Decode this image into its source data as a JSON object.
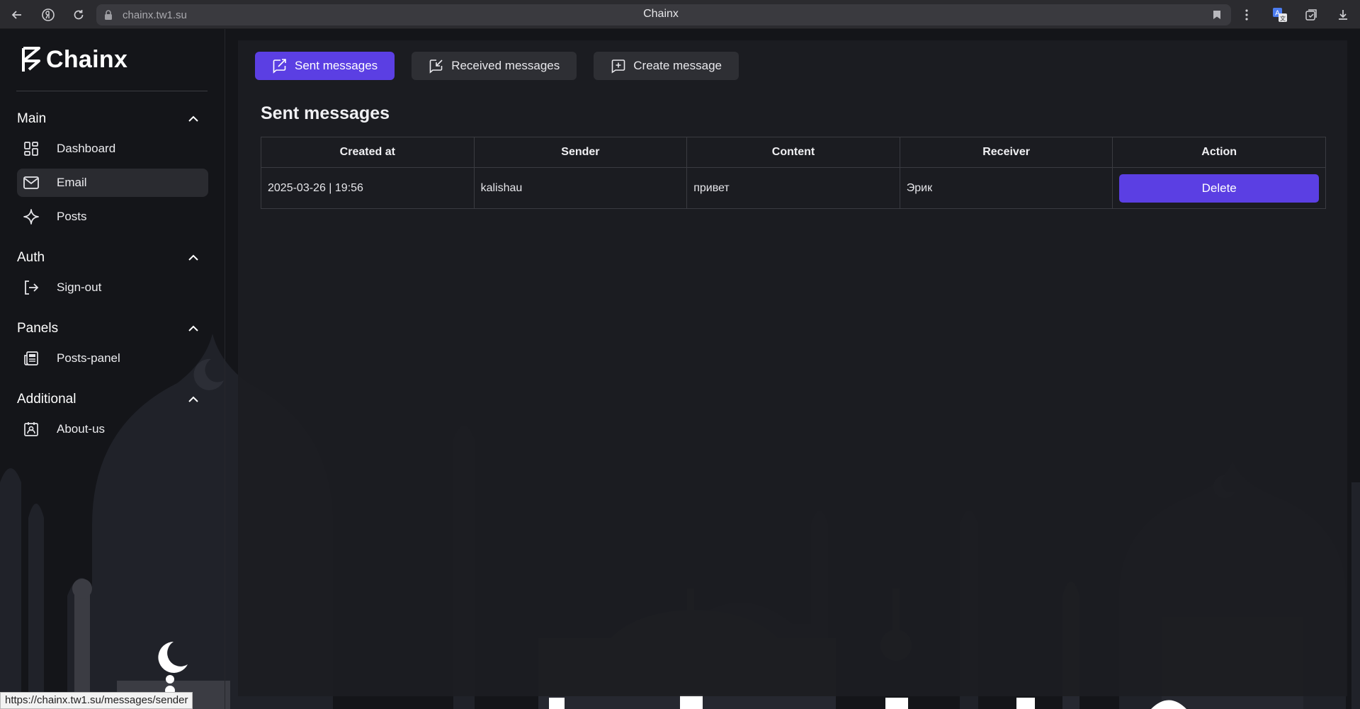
{
  "browser": {
    "url": "chainx.tw1.su",
    "tab_title": "Chainx"
  },
  "brand": {
    "name": "Chainx"
  },
  "sidebar": {
    "sections": [
      {
        "title": "Main",
        "items": [
          {
            "label": "Dashboard",
            "icon": "dashboard-icon"
          },
          {
            "label": "Email",
            "icon": "mail-icon",
            "active": true
          },
          {
            "label": "Posts",
            "icon": "sparkle-icon"
          }
        ]
      },
      {
        "title": "Auth",
        "items": [
          {
            "label": "Sign-out",
            "icon": "sign-out-icon"
          }
        ]
      },
      {
        "title": "Panels",
        "items": [
          {
            "label": "Posts-panel",
            "icon": "newspaper-icon"
          }
        ]
      },
      {
        "title": "Additional",
        "items": [
          {
            "label": "About-us",
            "icon": "contact-card-icon"
          }
        ]
      }
    ]
  },
  "main": {
    "tabs": [
      {
        "label": "Sent messages",
        "icon": "send-message-icon",
        "active": true
      },
      {
        "label": "Received messages",
        "icon": "received-message-icon"
      },
      {
        "label": "Create message",
        "icon": "add-message-icon"
      }
    ],
    "title": "Sent messages",
    "table": {
      "headers": [
        "Created at",
        "Sender",
        "Content",
        "Receiver",
        "Action"
      ],
      "rows": [
        {
          "created_at": "2025-03-26 | 19:56",
          "sender": "kalishau",
          "content": "привет",
          "receiver": "Эрик",
          "action": "Delete"
        }
      ]
    }
  },
  "status_bar": {
    "url": "https://chainx.tw1.su/messages/sender"
  },
  "colors": {
    "accent": "#5b3fe3",
    "background": "#141519",
    "panel": "#1c1d22"
  }
}
